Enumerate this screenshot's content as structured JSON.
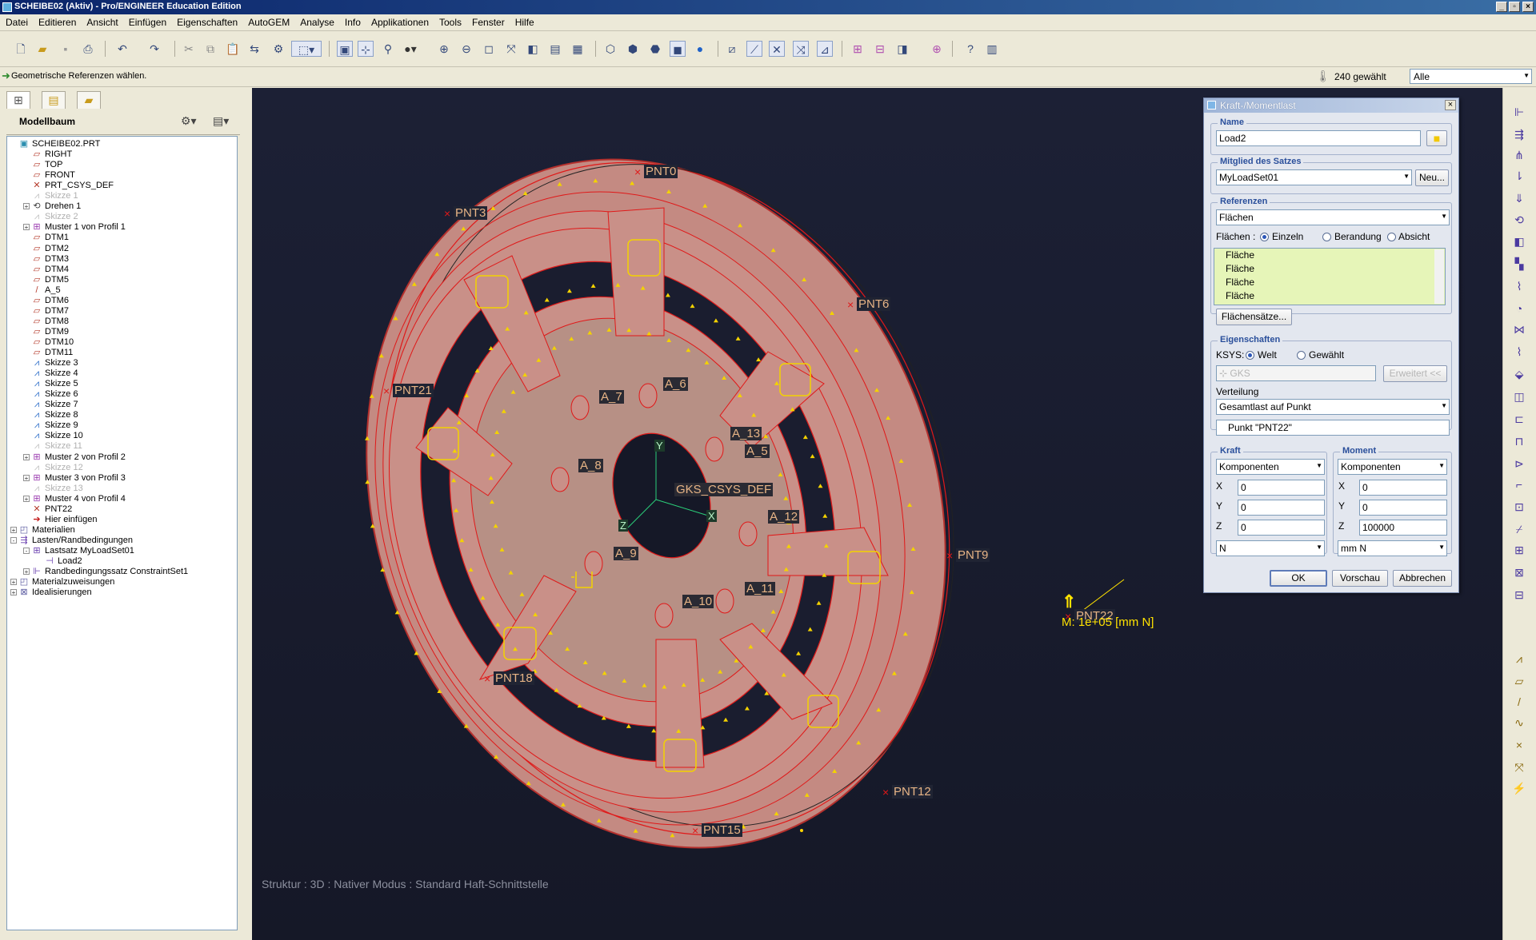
{
  "window": {
    "title": "SCHEIBE02 (Aktiv) - Pro/ENGINEER Education Edition"
  },
  "menu": [
    "Datei",
    "Editieren",
    "Ansicht",
    "Einfügen",
    "Eigenschaften",
    "AutoGEM",
    "Analyse",
    "Info",
    "Applikationen",
    "Tools",
    "Fenster",
    "Hilfe"
  ],
  "status": {
    "message": "Geometrische Referenzen wählen.",
    "selected_count": "240 gewählt",
    "filter": "Alle"
  },
  "tree": {
    "title": "Modellbaum",
    "items": [
      {
        "label": "SCHEIBE02.PRT",
        "icon": "part-icon",
        "indent": 0,
        "expand": "",
        "dim": false
      },
      {
        "label": "RIGHT",
        "icon": "datum-plane-icon",
        "indent": 1,
        "expand": "",
        "dim": false
      },
      {
        "label": "TOP",
        "icon": "datum-plane-icon",
        "indent": 1,
        "expand": "",
        "dim": false
      },
      {
        "label": "FRONT",
        "icon": "datum-plane-icon",
        "indent": 1,
        "expand": "",
        "dim": false
      },
      {
        "label": "PRT_CSYS_DEF",
        "icon": "csys-icon",
        "indent": 1,
        "expand": "",
        "dim": false
      },
      {
        "label": "Skizze 1",
        "icon": "sketch-icon",
        "indent": 1,
        "expand": "",
        "dim": true
      },
      {
        "label": "Drehen 1",
        "icon": "revolve-icon",
        "indent": 1,
        "expand": "+",
        "dim": false
      },
      {
        "label": "Skizze 2",
        "icon": "sketch-icon",
        "indent": 1,
        "expand": "",
        "dim": true
      },
      {
        "label": "Muster 1 von Profil 1",
        "icon": "pattern-icon",
        "indent": 1,
        "expand": "+",
        "dim": false
      },
      {
        "label": "DTM1",
        "icon": "datum-plane-icon",
        "indent": 1,
        "expand": "",
        "dim": false
      },
      {
        "label": "DTM2",
        "icon": "datum-plane-icon",
        "indent": 1,
        "expand": "",
        "dim": false
      },
      {
        "label": "DTM3",
        "icon": "datum-plane-icon",
        "indent": 1,
        "expand": "",
        "dim": false
      },
      {
        "label": "DTM4",
        "icon": "datum-plane-icon",
        "indent": 1,
        "expand": "",
        "dim": false
      },
      {
        "label": "DTM5",
        "icon": "datum-plane-icon",
        "indent": 1,
        "expand": "",
        "dim": false
      },
      {
        "label": "A_5",
        "icon": "datum-axis-icon",
        "indent": 1,
        "expand": "",
        "dim": false
      },
      {
        "label": "DTM6",
        "icon": "datum-plane-icon",
        "indent": 1,
        "expand": "",
        "dim": false
      },
      {
        "label": "DTM7",
        "icon": "datum-plane-icon",
        "indent": 1,
        "expand": "",
        "dim": false
      },
      {
        "label": "DTM8",
        "icon": "datum-plane-icon",
        "indent": 1,
        "expand": "",
        "dim": false
      },
      {
        "label": "DTM9",
        "icon": "datum-plane-icon",
        "indent": 1,
        "expand": "",
        "dim": false
      },
      {
        "label": "DTM10",
        "icon": "datum-plane-icon",
        "indent": 1,
        "expand": "",
        "dim": false
      },
      {
        "label": "DTM11",
        "icon": "datum-plane-icon",
        "indent": 1,
        "expand": "",
        "dim": false
      },
      {
        "label": "Skizze 3",
        "icon": "sketch-icon",
        "indent": 1,
        "expand": "",
        "dim": false
      },
      {
        "label": "Skizze 4",
        "icon": "sketch-icon",
        "indent": 1,
        "expand": "",
        "dim": false
      },
      {
        "label": "Skizze 5",
        "icon": "sketch-icon",
        "indent": 1,
        "expand": "",
        "dim": false
      },
      {
        "label": "Skizze 6",
        "icon": "sketch-icon",
        "indent": 1,
        "expand": "",
        "dim": false
      },
      {
        "label": "Skizze 7",
        "icon": "sketch-icon",
        "indent": 1,
        "expand": "",
        "dim": false
      },
      {
        "label": "Skizze 8",
        "icon": "sketch-icon",
        "indent": 1,
        "expand": "",
        "dim": false
      },
      {
        "label": "Skizze 9",
        "icon": "sketch-icon",
        "indent": 1,
        "expand": "",
        "dim": false
      },
      {
        "label": "Skizze 10",
        "icon": "sketch-icon",
        "indent": 1,
        "expand": "",
        "dim": false
      },
      {
        "label": "Skizze 11",
        "icon": "sketch-icon",
        "indent": 1,
        "expand": "",
        "dim": true
      },
      {
        "label": "Muster 2 von Profil 2",
        "icon": "pattern-icon",
        "indent": 1,
        "expand": "+",
        "dim": false
      },
      {
        "label": "Skizze 12",
        "icon": "sketch-icon",
        "indent": 1,
        "expand": "",
        "dim": true
      },
      {
        "label": "Muster 3 von Profil 3",
        "icon": "pattern-icon",
        "indent": 1,
        "expand": "+",
        "dim": false
      },
      {
        "label": "Skizze 13",
        "icon": "sketch-icon",
        "indent": 1,
        "expand": "",
        "dim": true
      },
      {
        "label": "Muster 4 von Profil 4",
        "icon": "pattern-icon",
        "indent": 1,
        "expand": "+",
        "dim": false
      },
      {
        "label": "PNT22",
        "icon": "datum-point-icon",
        "indent": 1,
        "expand": "",
        "dim": false
      },
      {
        "label": "Hier einfügen",
        "icon": "insert-arrow-icon",
        "indent": 1,
        "expand": "",
        "dim": false
      },
      {
        "label": "Materialien",
        "icon": "material-icon",
        "indent": 0,
        "expand": "+",
        "dim": false
      },
      {
        "label": "Lasten/Randbedingungen",
        "icon": "loads-icon",
        "indent": 0,
        "expand": "-",
        "dim": false
      },
      {
        "label": "Lastsatz MyLoadSet01",
        "icon": "loadset-icon",
        "indent": 1,
        "expand": "-",
        "dim": false
      },
      {
        "label": "Load2",
        "icon": "load-icon",
        "indent": 2,
        "expand": "",
        "dim": false
      },
      {
        "label": "Randbedingungssatz ConstraintSet1",
        "icon": "constraint-icon",
        "indent": 1,
        "expand": "+",
        "dim": false
      },
      {
        "label": "Materialzuweisungen",
        "icon": "material-assign-icon",
        "indent": 0,
        "expand": "+",
        "dim": false
      },
      {
        "label": "Idealisierungen",
        "icon": "idealization-icon",
        "indent": 0,
        "expand": "+",
        "dim": false
      }
    ]
  },
  "viewport": {
    "point_labels": [
      "PNT0",
      "PNT3",
      "PNT6",
      "PNT21",
      "PNT9",
      "PNT18",
      "PNT12",
      "PNT15",
      "PNT22"
    ],
    "axis_labels": [
      "A_7",
      "A_6",
      "A_13",
      "A_5",
      "A_8",
      "A_12",
      "A_9",
      "A_10",
      "A_11"
    ],
    "csys_label": "GKS_CSYS_DEF",
    "csys_axes": [
      "Y",
      "X",
      "Z"
    ],
    "load_label": "M: 1e+05 [mm N]",
    "structure_text": "Struktur : 3D : Nativer Modus : Standard Haft-Schnittstelle"
  },
  "dialog": {
    "title": "Kraft-/Momentlast",
    "name_group": "Name",
    "name_value": "Load2",
    "member_group": "Mitglied des Satzes",
    "member_value": "MyLoadSet01",
    "new_button": "Neu...",
    "references_group": "Referenzen",
    "references_type": "Flächen",
    "flaechen_label": "Flächen :",
    "radio_single": "Einzeln",
    "radio_boundary": "Berandung",
    "radio_intent": "Absicht",
    "surfaces": [
      "Fläche",
      "Fläche",
      "Fläche",
      "Fläche"
    ],
    "surface_sets_button": "Flächensätze...",
    "properties_group": "Eigenschaften",
    "ksys_label": "KSYS:",
    "radio_world": "Welt",
    "radio_selected": "Gewählt",
    "gks_placeholder": "GKS",
    "advanced_button": "Erweitert <<",
    "distribution_label": "Verteilung",
    "distribution_value": "Gesamtlast auf Punkt",
    "point_value": "Punkt \"PNT22\"",
    "force_group": "Kraft",
    "force_mode": "Komponenten",
    "force_x": "0",
    "force_y": "0",
    "force_z": "0",
    "force_unit": "N",
    "moment_group": "Moment",
    "moment_mode": "Komponenten",
    "moment_x": "0",
    "moment_y": "0",
    "moment_z": "100000",
    "moment_unit": "mm N",
    "axis_x": "X",
    "axis_y": "Y",
    "axis_z": "Z",
    "ok_button": "OK",
    "preview_button": "Vorschau",
    "cancel_button": "Abbrechen"
  }
}
